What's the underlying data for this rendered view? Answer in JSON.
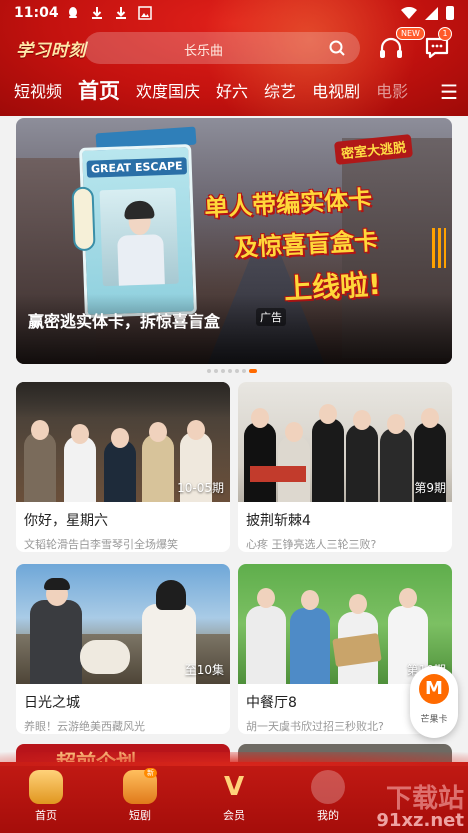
{
  "status_bar": {
    "time": "11:04"
  },
  "header": {
    "logo": "学习时刻",
    "search_placeholder": "长乐曲",
    "headphone_badge": "NEW",
    "message_badge": "1"
  },
  "tabs": [
    {
      "label": "短视频"
    },
    {
      "label": "首页"
    },
    {
      "label": "欢度国庆"
    },
    {
      "label": "好六"
    },
    {
      "label": "综艺"
    },
    {
      "label": "电视剧"
    },
    {
      "label": "电影"
    }
  ],
  "banner": {
    "card_title": "GREAT ESCAPE",
    "brand": "密室大逃脱",
    "headline_1": "单人带编实体卡",
    "headline_2": "及惊喜盲盒卡",
    "headline_3": "上线啦!",
    "caption": "赢密逃实体卡，拆惊喜盲盒",
    "ad_label": "广告"
  },
  "cards": [
    {
      "title": "你好，星期六",
      "subtitle": "文韬轮滑告白李雪琴引全场爆笑",
      "episode": "10-05期"
    },
    {
      "title": "披荆斩棘4",
      "subtitle": "心疼 王铮亮选人三轮三败?",
      "episode": "第9期"
    },
    {
      "title": "日光之城",
      "subtitle": "养眼！云游绝美西藏风光",
      "episode": "至10集"
    },
    {
      "title": "中餐厅8",
      "subtitle": "胡一天虞书欣过招三秒败北?",
      "episode": "第10期"
    }
  ],
  "next_row": {
    "left_title": "超前企划"
  },
  "mango_card": {
    "logo_letter": "M",
    "label": "芒果卡"
  },
  "bottom_nav": [
    {
      "label": "首页"
    },
    {
      "label": "短剧",
      "badge": "新"
    },
    {
      "label": "会员"
    },
    {
      "label": "我的"
    }
  ],
  "watermark": {
    "text": "91xz.net",
    "top_text": "下载站"
  },
  "colors": {
    "header_red": "#c4120f",
    "accent_orange": "#ff6a00",
    "headline_yellow": "#ffd83a"
  }
}
